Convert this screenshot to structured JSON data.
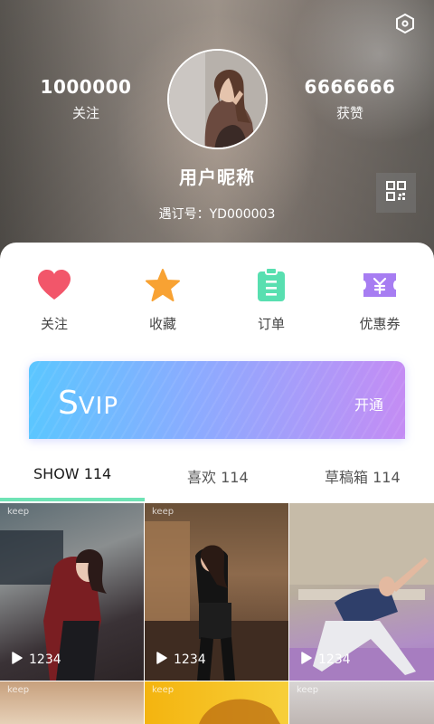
{
  "profile": {
    "following_count": "1000000",
    "following_label": "关注",
    "likes_count": "6666666",
    "likes_label": "获赞",
    "nickname": "用户昵称",
    "id_label": "遇订号：YD000003"
  },
  "quick_actions": [
    {
      "label": "关注",
      "icon": "heart-icon",
      "color": "#f2566a"
    },
    {
      "label": "收藏",
      "icon": "star-icon",
      "color": "#f8a233"
    },
    {
      "label": "订单",
      "icon": "clipboard-icon",
      "color": "#58dfb0"
    },
    {
      "label": "优惠券",
      "icon": "coupon-icon",
      "color": "#a77df2"
    }
  ],
  "svip": {
    "title_initial": "S",
    "title_rest": "VIP",
    "action_label": "开通"
  },
  "tabs": [
    {
      "label": "SHOW 114",
      "active": true
    },
    {
      "label": "喜欢 114",
      "active": false
    },
    {
      "label": "草稿箱 114",
      "active": false
    }
  ],
  "tiles": [
    {
      "play_count": "1234",
      "watermark": "keep"
    },
    {
      "play_count": "1234",
      "watermark": "keep"
    },
    {
      "play_count": "1234",
      "watermark": ""
    },
    {
      "play_count": "",
      "watermark": "keep"
    },
    {
      "play_count": "",
      "watermark": "keep"
    },
    {
      "play_count": "",
      "watermark": "keep"
    }
  ],
  "colors": {
    "tab_indicator": "#6fe3b5",
    "svip_gradient_start": "#5bc6ff",
    "svip_gradient_end": "#c48cf4"
  }
}
